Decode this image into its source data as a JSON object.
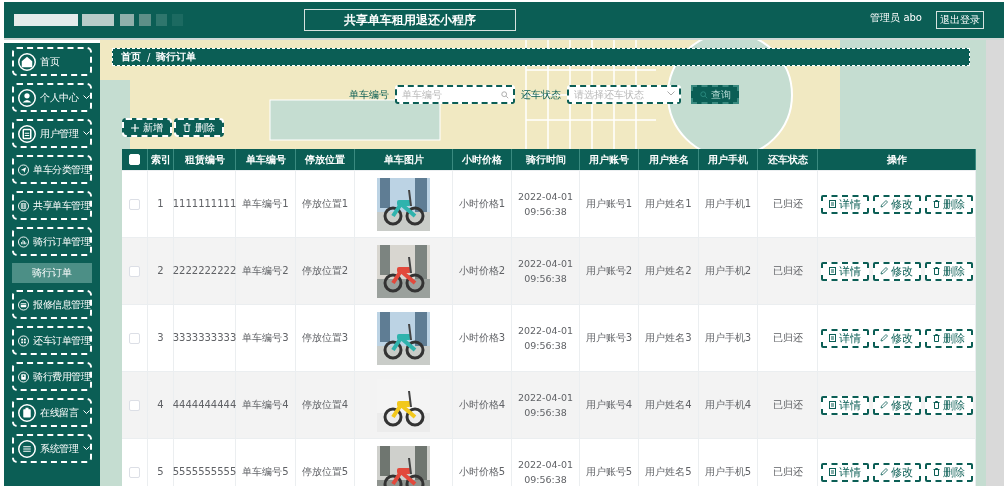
{
  "header": {
    "title": "共享单车租用退还小程序",
    "user": "管理员 abo",
    "logout": "退出登录"
  },
  "sidebar": {
    "items": [
      {
        "label": "首页",
        "chevron": false,
        "selected": false
      },
      {
        "label": "个人中心",
        "chevron": true,
        "selected": false
      },
      {
        "label": "用户管理",
        "chevron": true,
        "selected": false
      },
      {
        "label": "单车分类管理",
        "chevron": false,
        "selected": false
      },
      {
        "label": "共享单车管理",
        "chevron": false,
        "selected": false
      },
      {
        "label": "骑行订单管理",
        "chevron": false,
        "selected": false,
        "children": [
          {
            "label": "骑行订单",
            "selected": true
          }
        ]
      },
      {
        "label": "报修信息管理",
        "chevron": false,
        "selected": false
      },
      {
        "label": "还车订单管理",
        "chevron": false,
        "selected": false
      },
      {
        "label": "骑行费用管理",
        "chevron": false,
        "selected": false
      },
      {
        "label": "在线留言",
        "chevron": true,
        "selected": false
      },
      {
        "label": "系统管理",
        "chevron": true,
        "selected": false
      }
    ]
  },
  "breadcrumb": {
    "items": [
      "首页",
      "骑行订单"
    ],
    "separator": "/"
  },
  "search": {
    "fields": [
      {
        "kind": "input",
        "label": "单车编号",
        "placeholder": "单车编号"
      },
      {
        "kind": "select",
        "label": "还车状态",
        "placeholder": "请选择还车状态"
      }
    ],
    "button": "查询"
  },
  "toolbar": [
    {
      "kind": "add",
      "label": "新增"
    },
    {
      "kind": "delete",
      "label": "删除"
    }
  ],
  "table": {
    "select_all_checked": false,
    "columns": [
      "索引",
      "租赁编号",
      "单车编号",
      "停放位置",
      "单车图片",
      "小时价格",
      "骑行时间",
      "用户账号",
      "用户姓名",
      "用户手机",
      "还车状态",
      "操作"
    ],
    "rows": [
      {
        "checked": false,
        "index": "1",
        "rental_no": "1111111111",
        "bike_no": "单车编号1",
        "location": "停放位置1",
        "price": "小时价格1",
        "time": "2022-04-01 09:56:38",
        "account": "用户账号1",
        "name": "用户姓名1",
        "phone": "用户手机1",
        "status": "已归还",
        "actions": [
          "详情",
          "修改",
          "删除"
        ]
      },
      {
        "checked": false,
        "index": "2",
        "rental_no": "2222222222",
        "bike_no": "单车编号2",
        "location": "停放位置2",
        "price": "小时价格2",
        "time": "2022-04-01 09:56:38",
        "account": "用户账号2",
        "name": "用户姓名2",
        "phone": "用户手机2",
        "status": "已归还",
        "actions": [
          "详情",
          "修改",
          "删除"
        ]
      },
      {
        "checked": false,
        "index": "3",
        "rental_no": "3333333333",
        "bike_no": "单车编号3",
        "location": "停放位置3",
        "price": "小时价格3",
        "time": "2022-04-01 09:56:38",
        "account": "用户账号3",
        "name": "用户姓名3",
        "phone": "用户手机3",
        "status": "已归还",
        "actions": [
          "详情",
          "修改",
          "删除"
        ]
      },
      {
        "checked": false,
        "index": "4",
        "rental_no": "4444444444",
        "bike_no": "单车编号4",
        "location": "停放位置4",
        "price": "小时价格4",
        "time": "2022-04-01 09:56:38",
        "account": "用户账号4",
        "name": "用户姓名4",
        "phone": "用户手机4",
        "status": "已归还",
        "actions": [
          "详情",
          "修改",
          "删除"
        ]
      },
      {
        "checked": false,
        "index": "5",
        "rental_no": "5555555555",
        "bike_no": "单车编号5",
        "location": "停放位置5",
        "price": "小时价格5",
        "time": "2022-04-01 09:56:38",
        "account": "用户账号5",
        "name": "用户姓名5",
        "phone": "用户手机5",
        "status": "已归还",
        "actions": [
          "详情",
          "修改",
          "删除"
        ]
      }
    ]
  }
}
